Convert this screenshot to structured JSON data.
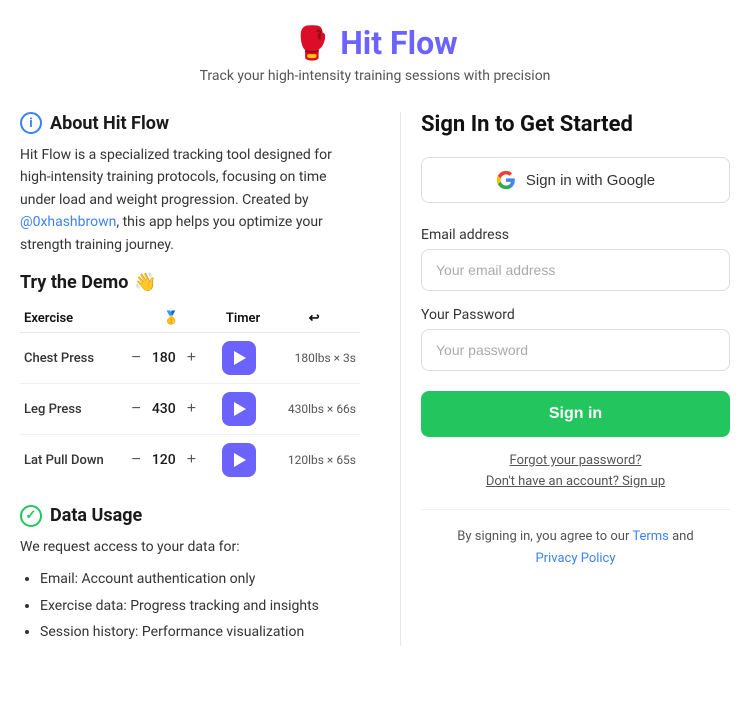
{
  "header": {
    "logo": "🥊",
    "name": "Hit Flow",
    "subtitle": "Track your high-intensity training sessions with precision"
  },
  "left": {
    "about": {
      "heading": "About Hit Flow",
      "text_part1": "Hit Flow is a specialized tracking tool designed for high-intensity training protocols, focusing on time under load and weight progression. Created by ",
      "link_text": "@0xhashbrown",
      "text_part2": ", this app helps you optimize your strength training journey."
    },
    "demo": {
      "heading": "Try the Demo",
      "emoji": "👋",
      "table": {
        "headers": [
          "Exercise",
          "🥇",
          "Timer",
          "↩"
        ],
        "rows": [
          {
            "name": "Chest Press",
            "weight": 180,
            "stats": "180lbs × 3s"
          },
          {
            "name": "Leg Press",
            "weight": 430,
            "stats": "430lbs × 66s"
          },
          {
            "name": "Lat Pull Down",
            "weight": 120,
            "stats": "120lbs × 65s"
          }
        ]
      }
    },
    "data_usage": {
      "heading": "Data Usage",
      "desc": "We request access to your data for:",
      "items": [
        "Email: Account authentication only",
        "Exercise data: Progress tracking and insights",
        "Session history: Performance visualization"
      ]
    }
  },
  "right": {
    "signin_title": "Sign In to Get Started",
    "google_btn_label": "Sign in with Google",
    "email_label": "Email address",
    "email_placeholder": "Your email address",
    "password_label": "Your Password",
    "password_placeholder": "Your password",
    "signin_btn": "Sign in",
    "forgot_password": "Forgot your password?",
    "signup_link": "Don't have an account? Sign up",
    "terms_prefix": "By signing in, you agree to our ",
    "terms_link": "Terms",
    "terms_mid": " and ",
    "privacy_link": "Privacy Policy"
  }
}
